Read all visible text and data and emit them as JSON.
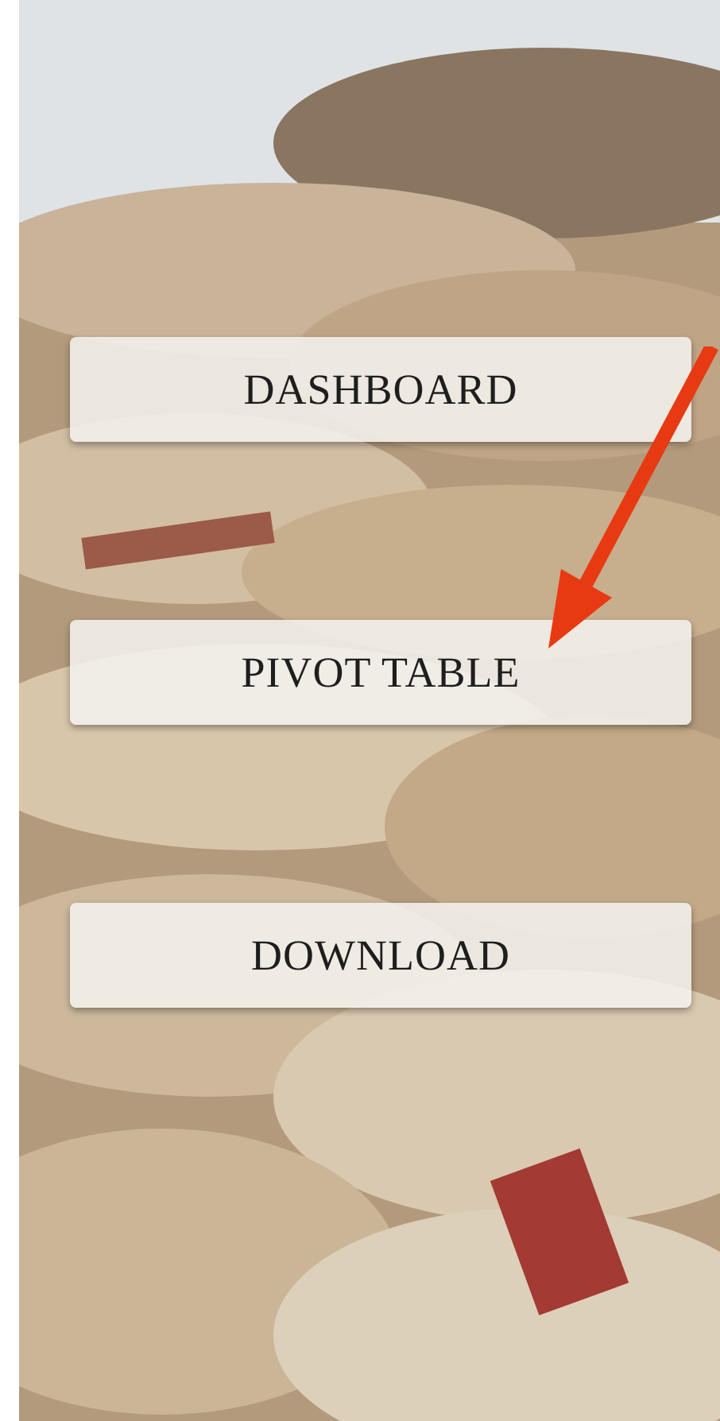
{
  "buttons": [
    {
      "label": "DASHBOARD"
    },
    {
      "label": "PIVOT TABLE"
    },
    {
      "label": "DOWNLOAD"
    }
  ]
}
